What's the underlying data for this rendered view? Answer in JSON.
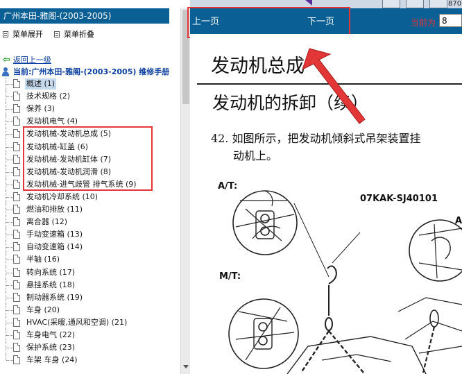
{
  "left_pane": {
    "title": "广州本田-雅阁-(2003-2005)",
    "toolbar": {
      "expand_label": "菜单展开",
      "collapse_label": "菜单折叠"
    },
    "back_link": "返回上一级",
    "current": "当前:广州本田-雅阁-(2003-2005) 维修手册",
    "tree_items": [
      {
        "label": "概述 (1)",
        "selected": true
      },
      {
        "label": "技术规格 (2)"
      },
      {
        "label": "保养 (3)"
      },
      {
        "label": "发动机电气 (4)"
      },
      {
        "label": "发动机械-发动机总成 (5)"
      },
      {
        "label": "发动机械-缸盖 (6)"
      },
      {
        "label": "发动机械-发动机缸体 (7)"
      },
      {
        "label": "发动机械-发动机润滑 (8)"
      },
      {
        "label": "发动机械-进气歧管 排气系统 (9)"
      },
      {
        "label": "发动机冷却系统 (10)"
      },
      {
        "label": "燃油和排放 (11)"
      },
      {
        "label": "离合器 (12)"
      },
      {
        "label": "手动变速箱 (13)"
      },
      {
        "label": "自动变速箱 (14)"
      },
      {
        "label": "半轴 (16)"
      },
      {
        "label": "转向系统 (17)"
      },
      {
        "label": "悬挂系统 (18)"
      },
      {
        "label": "制动器系统 (19)"
      },
      {
        "label": "车身 (20)"
      },
      {
        "label": "HVAC(采暖,通风和空调) (21)"
      },
      {
        "label": "车身电气 (22)"
      },
      {
        "label": "保护系统 (23)"
      },
      {
        "label": "车架 车身 (24)"
      }
    ]
  },
  "nav": {
    "prev_label": "上一页",
    "next_label": "下一页",
    "current_page_label": "当前为",
    "current_page_value": "8",
    "top_number": "870"
  },
  "content": {
    "title": "发动机总成",
    "section": "发动机的拆卸（续）",
    "step_line1": "42. 如图所示，把发动机倾斜式吊架装置挂",
    "step_line2": "动机上。",
    "label_at": "A/T:",
    "label_mt": "M/T:",
    "part_number": "07KAK-SJ40101",
    "label_right": "A/"
  },
  "colors": {
    "header_blue": "#0a5f94",
    "highlight_red": "#e33636",
    "link_blue": "#0a3fa0"
  }
}
